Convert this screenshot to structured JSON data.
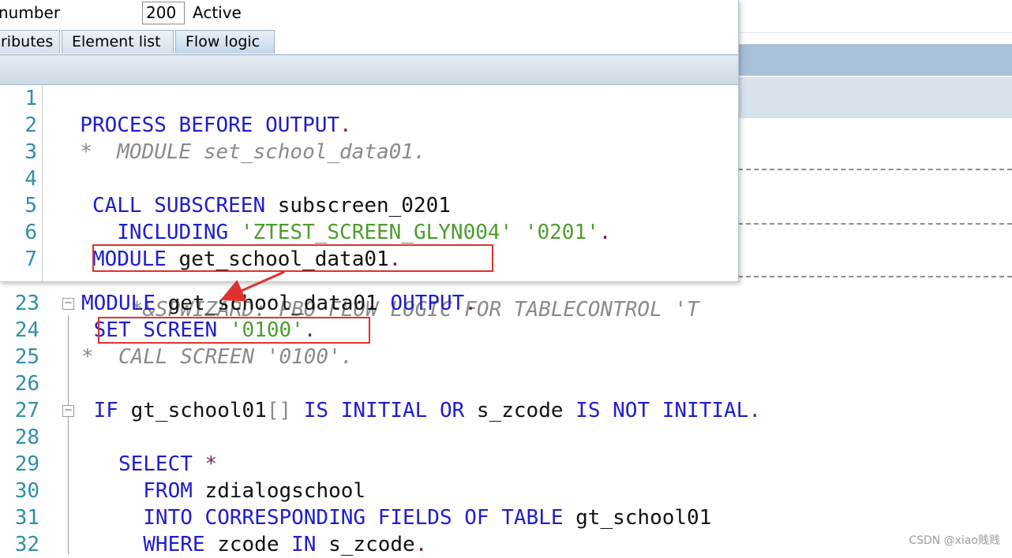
{
  "popup": {
    "number_label": "number",
    "number_value": "200",
    "status": "Active",
    "tabs": [
      {
        "label": "ributes",
        "active": false
      },
      {
        "label": "Element list",
        "active": false
      },
      {
        "label": "Flow logic",
        "active": true
      }
    ],
    "lines": [
      {
        "num": "1",
        "tokens": []
      },
      {
        "num": "2",
        "tokens": [
          {
            "t": "  ",
            "c": "id"
          },
          {
            "t": "PROCESS BEFORE OUTPUT",
            "c": "kw"
          },
          {
            "t": ".",
            "c": "pt"
          }
        ]
      },
      {
        "num": "3",
        "tokens": [
          {
            "t": "  *  MODULE set_school_data01.",
            "c": "cmt"
          }
        ]
      },
      {
        "num": "4",
        "tokens": []
      },
      {
        "num": "5",
        "tokens": [
          {
            "t": "   ",
            "c": "id"
          },
          {
            "t": "CALL SUBSCREEN",
            "c": "kw"
          },
          {
            "t": " subscreen_0201",
            "c": "id"
          }
        ]
      },
      {
        "num": "6",
        "tokens": [
          {
            "t": "     ",
            "c": "id"
          },
          {
            "t": "INCLUDING",
            "c": "kw"
          },
          {
            "t": " 'ZTEST_SCREEN_GLYN004' '0201'",
            "c": "str"
          },
          {
            "t": ".",
            "c": "pt"
          }
        ]
      },
      {
        "num": "7",
        "tokens": [
          {
            "t": "   ",
            "c": "id"
          },
          {
            "t": "MODULE",
            "c": "kw"
          },
          {
            "t": " get_school_data01",
            "c": "id"
          },
          {
            "t": ".",
            "c": "pt"
          }
        ]
      }
    ]
  },
  "editor": {
    "partial_line": "*&SPWIZARD: PBO FLOW LOGIC FOR TABLECONTROL 'T",
    "lines": [
      {
        "num": "23",
        "fold": true,
        "tokens": [
          {
            "t": "MODULE",
            "c": "kw"
          },
          {
            "t": " get_school_data01 ",
            "c": "id"
          },
          {
            "t": "OUTPUT",
            "c": "kw"
          },
          {
            "t": ".",
            "c": "pt"
          }
        ]
      },
      {
        "num": "24",
        "fold": false,
        "tokens": [
          {
            "t": " ",
            "c": "id"
          },
          {
            "t": "SET SCREEN",
            "c": "kw"
          },
          {
            "t": " '0100'",
            "c": "str"
          },
          {
            "t": ".",
            "c": "pt"
          }
        ]
      },
      {
        "num": "25",
        "fold": false,
        "tokens": [
          {
            "t": "*  CALL SCREEN '0100'.",
            "c": "cmt"
          }
        ]
      },
      {
        "num": "26",
        "fold": false,
        "tokens": []
      },
      {
        "num": "27",
        "fold": true,
        "tokens": [
          {
            "t": " ",
            "c": "id"
          },
          {
            "t": "IF",
            "c": "kw"
          },
          {
            "t": " gt_school01",
            "c": "id"
          },
          {
            "t": "[]",
            "c": "br"
          },
          {
            "t": " ",
            "c": "id"
          },
          {
            "t": "IS INITIAL OR",
            "c": "kw"
          },
          {
            "t": " s_zcode ",
            "c": "id"
          },
          {
            "t": "IS NOT INITIAL",
            "c": "kw"
          },
          {
            "t": ".",
            "c": "pt"
          }
        ]
      },
      {
        "num": "28",
        "fold": false,
        "tokens": []
      },
      {
        "num": "29",
        "fold": false,
        "tokens": [
          {
            "t": "   ",
            "c": "id"
          },
          {
            "t": "SELECT",
            "c": "kw"
          },
          {
            "t": " *",
            "c": "pt"
          }
        ]
      },
      {
        "num": "30",
        "fold": false,
        "tokens": [
          {
            "t": "     ",
            "c": "id"
          },
          {
            "t": "FROM",
            "c": "kw"
          },
          {
            "t": " zdialogschool",
            "c": "id"
          }
        ]
      },
      {
        "num": "31",
        "fold": false,
        "tokens": [
          {
            "t": "     ",
            "c": "id"
          },
          {
            "t": "INTO CORRESPONDING FIELDS OF TABLE",
            "c": "kw"
          },
          {
            "t": " gt_school01",
            "c": "id"
          }
        ]
      },
      {
        "num": "32",
        "fold": false,
        "tokens": [
          {
            "t": "     ",
            "c": "id"
          },
          {
            "t": "WHERE",
            "c": "kw"
          },
          {
            "t": " zcode ",
            "c": "id"
          },
          {
            "t": "IN",
            "c": "kw"
          },
          {
            "t": " s_zcode",
            "c": "id"
          },
          {
            "t": ".",
            "c": "pt"
          }
        ]
      }
    ]
  },
  "watermark": "CSDN @xiao贱贱",
  "colors": {
    "keyword": "#1d1dce",
    "string": "#4d9c2e",
    "comment": "#8a8a8a",
    "highlight": "#e0312f",
    "line_number": "#2f8fa6"
  }
}
